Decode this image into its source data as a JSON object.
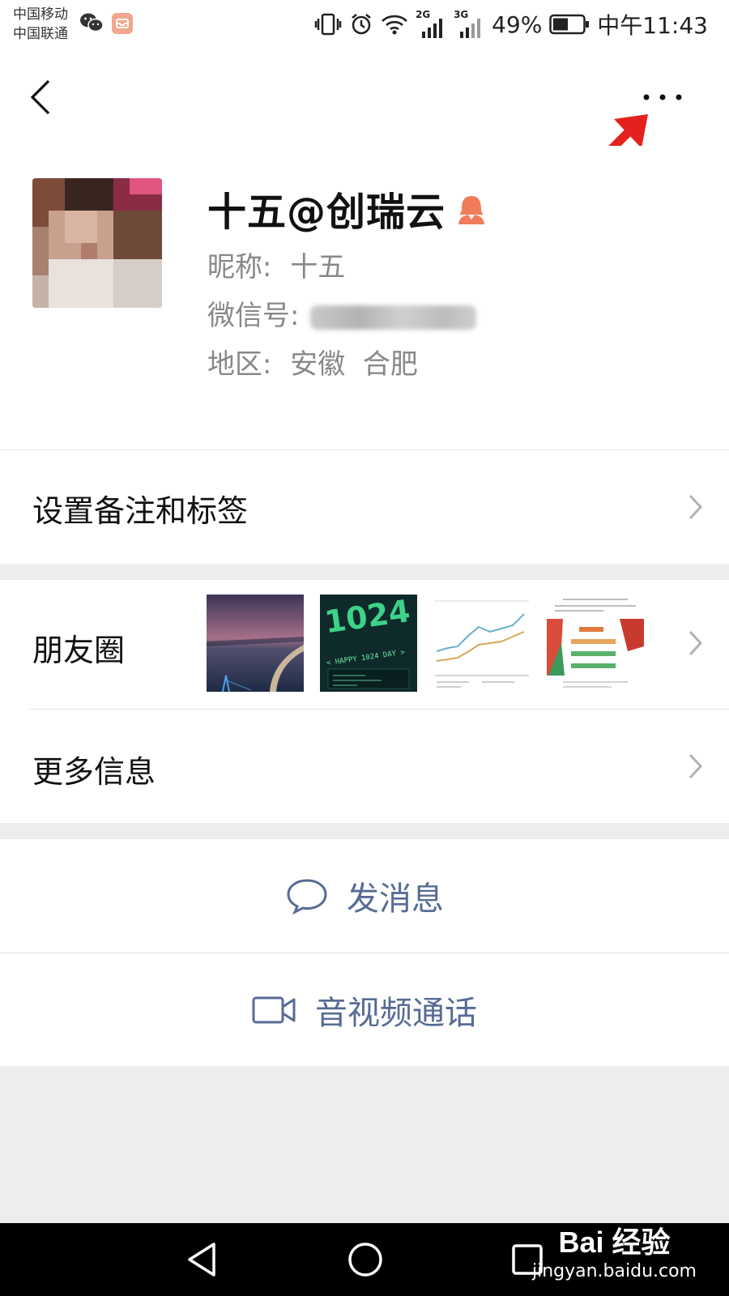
{
  "status_bar": {
    "carrier_1": "中国移动",
    "carrier_2": "中国联通",
    "net_2": "2G",
    "net_3": "3G",
    "battery": "49%",
    "time": "中午11:43"
  },
  "profile": {
    "display_name": "十五@创瑞云",
    "nickname_label": "昵称:",
    "nickname": "十五",
    "wechat_id_label": "微信号:",
    "region_label": "地区:",
    "region": "安徽  合肥"
  },
  "menu": {
    "remarks_tags": "设置备注和标签",
    "moments": "朋友圈",
    "more_info": "更多信息"
  },
  "actions": {
    "send_message": "发消息",
    "av_call": "音视频通话"
  },
  "thumb_text": {
    "happy": "< HAPPY 1024 DAY >",
    "big_1024": "1024"
  },
  "watermark": {
    "brand": "Bai 经验",
    "url": "jingyan.baidu.com"
  },
  "colors": {
    "link_blue": "#576b95",
    "arrow_red": "#e5211d",
    "background": "#ededed"
  }
}
